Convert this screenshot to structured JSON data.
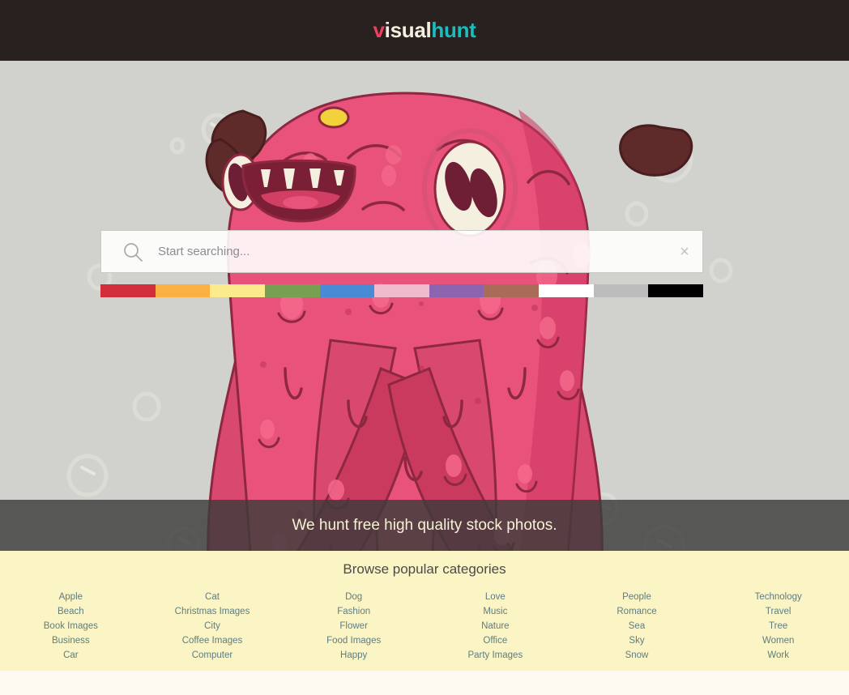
{
  "header": {
    "logo": {
      "part1": "v",
      "part2": "isual",
      "part3": "hunt"
    },
    "background_color": "#292120"
  },
  "hero": {
    "background_color": "#d1d2cd",
    "illustration": "pink-monster-illustration"
  },
  "search": {
    "placeholder": "Start searching...",
    "value": "",
    "search_icon": "magnifier-icon",
    "clear_icon": "close-x-icon",
    "clear_label": "×"
  },
  "color_filters": [
    {
      "name": "red",
      "hex": "#d22d3a"
    },
    {
      "name": "orange",
      "hex": "#fbb042"
    },
    {
      "name": "yellow",
      "hex": "#fbeb8d"
    },
    {
      "name": "green",
      "hex": "#77a053"
    },
    {
      "name": "blue",
      "hex": "#4a8bd6"
    },
    {
      "name": "pink",
      "hex": "#f0bccd"
    },
    {
      "name": "purple",
      "hex": "#8c64b0"
    },
    {
      "name": "brown",
      "hex": "#a96c59"
    },
    {
      "name": "white",
      "hex": "#ffffff"
    },
    {
      "name": "gray",
      "hex": "#bcbcbc"
    },
    {
      "name": "black",
      "hex": "#000000"
    }
  ],
  "tagline": {
    "text": "We hunt free high quality stock photos."
  },
  "categories": {
    "title": "Browse popular categories",
    "columns": [
      {
        "items": [
          "Apple",
          "Beach",
          "Book Images",
          "Business",
          "Car"
        ]
      },
      {
        "items": [
          "Cat",
          "Christmas Images",
          "City",
          "Coffee Images",
          "Computer"
        ]
      },
      {
        "items": [
          "Dog",
          "Fashion",
          "Flower",
          "Food Images",
          "Happy"
        ]
      },
      {
        "items": [
          "Love",
          "Music",
          "Nature",
          "Office",
          "Party Images"
        ]
      },
      {
        "items": [
          "People",
          "Romance",
          "Sea",
          "Sky",
          "Snow"
        ]
      },
      {
        "items": [
          "Technology",
          "Travel",
          "Tree",
          "Women",
          "Work"
        ]
      }
    ]
  }
}
